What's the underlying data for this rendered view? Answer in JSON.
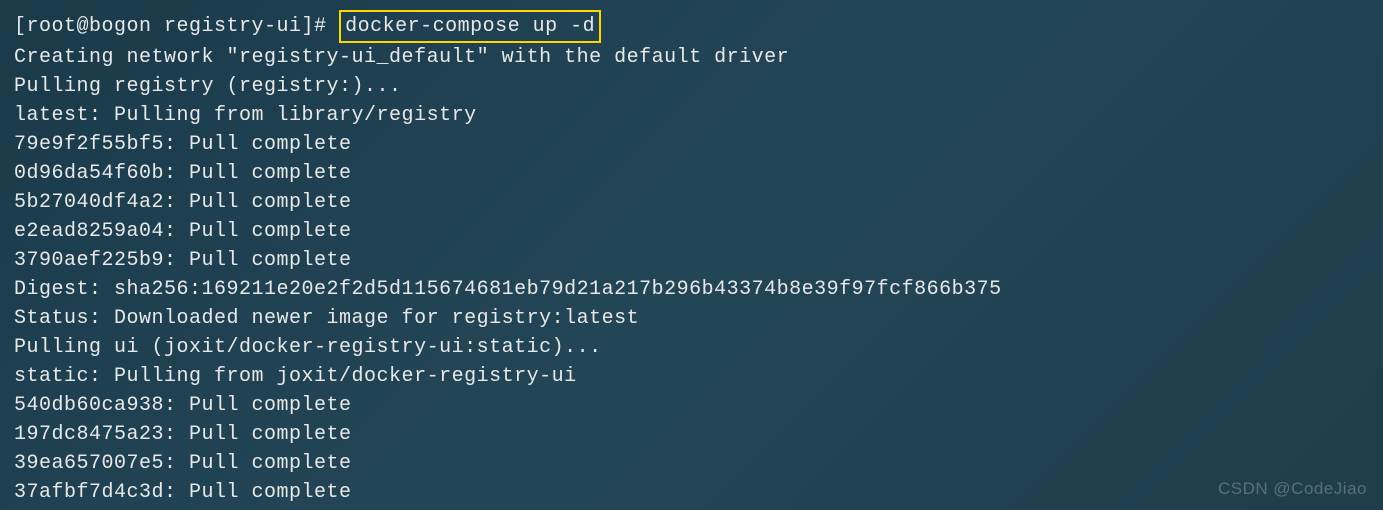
{
  "prompt": {
    "prefix": "[root@bogon registry-ui]# ",
    "command": "docker-compose up -d"
  },
  "output": [
    "Creating network \"registry-ui_default\" with the default driver",
    "Pulling registry (registry:)...",
    "latest: Pulling from library/registry",
    "79e9f2f55bf5: Pull complete",
    "0d96da54f60b: Pull complete",
    "5b27040df4a2: Pull complete",
    "e2ead8259a04: Pull complete",
    "3790aef225b9: Pull complete",
    "Digest: sha256:169211e20e2f2d5d115674681eb79d21a217b296b43374b8e39f97fcf866b375",
    "Status: Downloaded newer image for registry:latest",
    "Pulling ui (joxit/docker-registry-ui:static)...",
    "static: Pulling from joxit/docker-registry-ui",
    "540db60ca938: Pull complete",
    "197dc8475a23: Pull complete",
    "39ea657007e5: Pull complete",
    "37afbf7d4c3d: Pull complete"
  ],
  "watermark": "CSDN @CodeJiao"
}
